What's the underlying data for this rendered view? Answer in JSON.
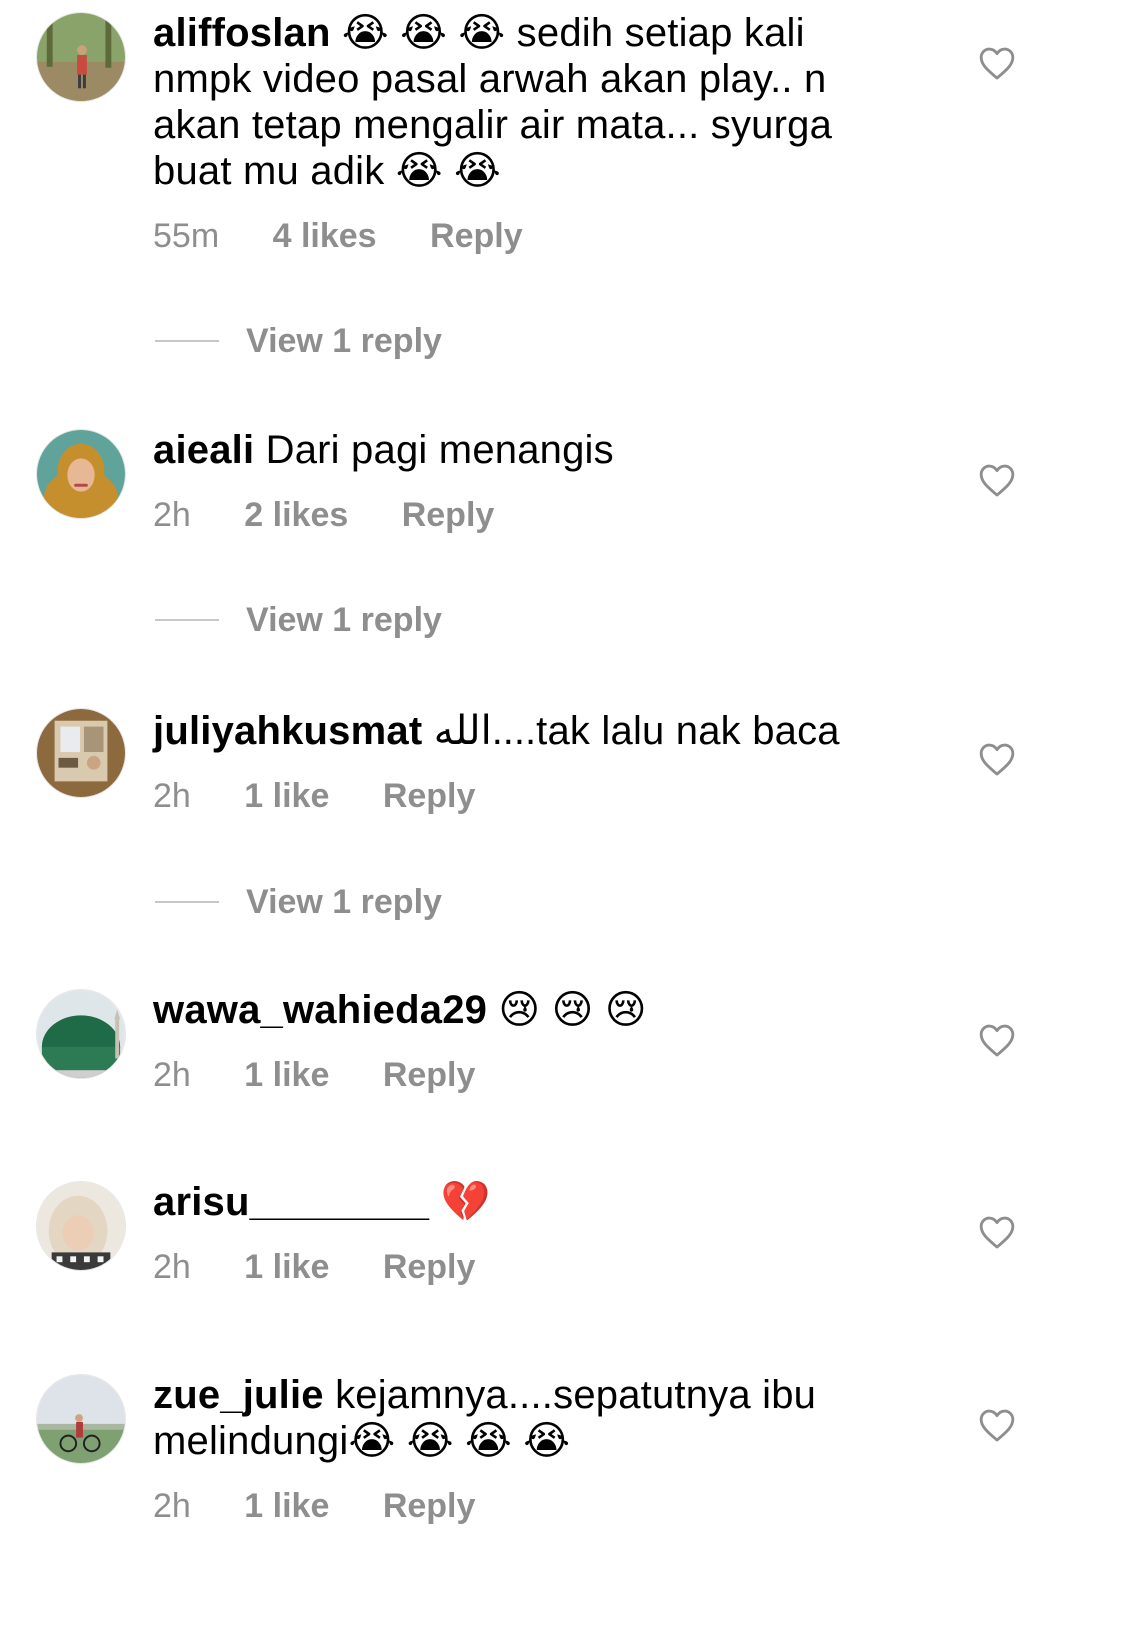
{
  "comments": [
    {
      "username": "aliffoslan",
      "text": "😭 😭 😭  sedih setiap kali nmpk video pasal arwah akan play.. n akan tetap mengalir air mata... syurga buat mu adik 😭 😭",
      "time": "55m",
      "likes": "4 likes",
      "reply": "Reply",
      "view_replies": "View 1 reply"
    },
    {
      "username": "aieali",
      "text": "Dari pagi menangis",
      "time": "2h",
      "likes": "2 likes",
      "reply": "Reply",
      "view_replies": "View 1 reply"
    },
    {
      "username": "juliyahkusmat",
      "text": "الله....tak lalu nak baca",
      "time": "2h",
      "likes": "1 like",
      "reply": "Reply",
      "view_replies": "View 1 reply"
    },
    {
      "username": "wawa_wahieda29",
      "text": "😢 😢 😢",
      "time": "2h",
      "likes": "1 like",
      "reply": "Reply"
    },
    {
      "username": "arisu________",
      "text": "💔",
      "time": "2h",
      "likes": "1 like",
      "reply": "Reply"
    },
    {
      "username": "zue_julie",
      "text": "kejamnya....sepatutnya ibu melindungi😭 😭 😭 😭",
      "time": "2h",
      "likes": "1 like",
      "reply": "Reply"
    }
  ],
  "icons": {
    "like": "heart-outline-icon"
  },
  "colors": {
    "secondary_text": "#8e8e8e",
    "divider": "#c7c7c7"
  }
}
